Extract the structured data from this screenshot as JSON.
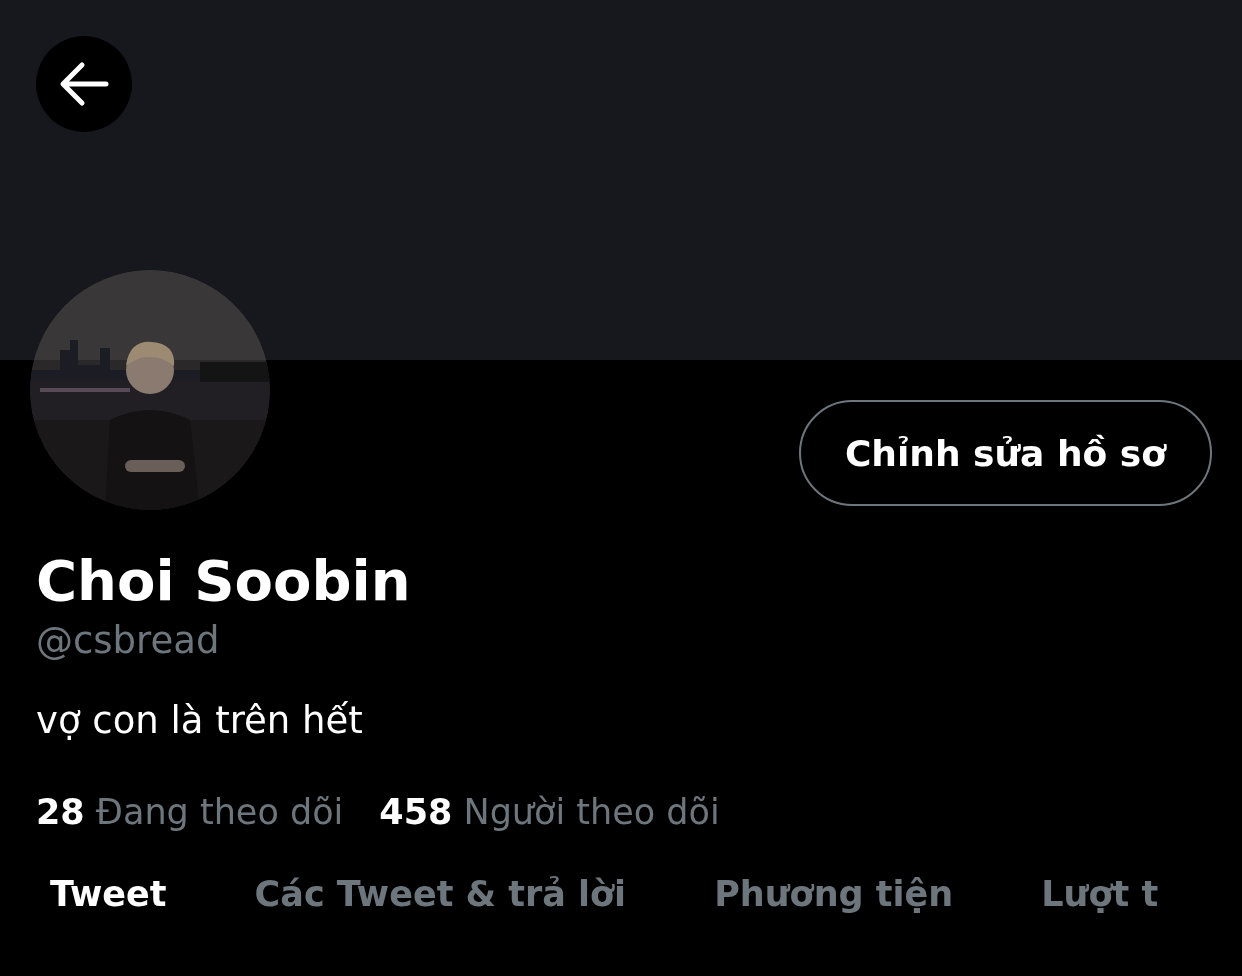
{
  "profile": {
    "name": "Choi Soobin",
    "handle": "@csbread",
    "bio": "vợ con là trên hết",
    "edit_button": "Chỉnh sửa hồ sơ"
  },
  "stats": [
    {
      "count": "28",
      "label": "Đang theo dõi"
    },
    {
      "count": "458",
      "label": "Người theo dõi"
    }
  ],
  "tabs": [
    {
      "label": "Tweet",
      "selected": true
    },
    {
      "label": "Các Tweet & trả lời",
      "selected": false
    },
    {
      "label": "Phương tiện",
      "selected": false
    },
    {
      "label": "Lượt t",
      "selected": false
    }
  ]
}
